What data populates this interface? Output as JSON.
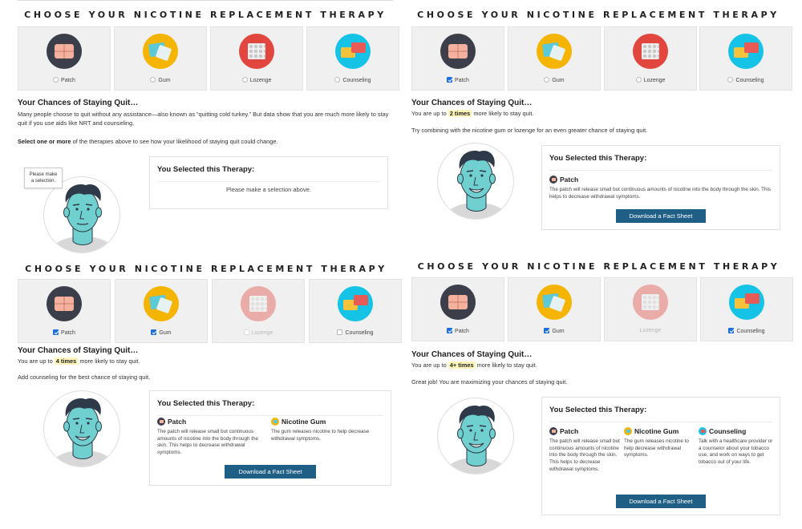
{
  "heading": "CHOOSE YOUR NICOTINE REPLACEMENT THERAPY",
  "options": [
    "Patch",
    "Gum",
    "Lozenge",
    "Counseling"
  ],
  "chances_title": "Your Chances of Staying Quit…",
  "selected_title": "You Selected this Therapy:",
  "download_label": "Download a Fact Sheet",
  "therapies": {
    "patch": {
      "name": "Patch",
      "desc": "The patch will release small but continuous amounts of nicotine into the body through the skin. This helps to decrease withdrawal symptoms."
    },
    "gum": {
      "name": "Nicotine Gum",
      "desc": "The gum releases nicotine to help decrease withdrawal symptoms."
    },
    "counseling": {
      "name": "Counseling",
      "desc": "Talk with a healthcare provider or a counselor about your tobacco use, and work on ways to get tobacco out of your life."
    }
  },
  "panel1": {
    "intro": "Many people choose to quit without any assistance—also known as “quitting cold turkey.” But data show that you are much more likely to stay quit if you use aids like NRT and counseling.",
    "instruction_bold": "Select one or more",
    "instruction_rest": " of the therapies above to see how your likelihood of staying quit could change.",
    "speech": "Please make a selection.",
    "empty_message": "Please make a selection above."
  },
  "panel2": {
    "prefix": "You are up to",
    "times": "2 times",
    "suffix": "more likely to stay quit.",
    "tip": "Try combining with the nicotine gum or lozenge for an even greater chance of staying quit."
  },
  "panel3": {
    "prefix": "You are up to",
    "times": "4 times",
    "suffix": "more likely to stay quit.",
    "tip": "Add counseling for the best chance of staying quit."
  },
  "panel4": {
    "prefix": "You are up to",
    "times": "4+ times",
    "suffix": "more likely to stay quit.",
    "tip": "Great job! You are maximizing your chances of staying quit."
  },
  "colors": {
    "patch": "#3c3f4a",
    "gum": "#f4b400",
    "lozenge": "#e2473f",
    "counseling": "#15c3e6",
    "skin": "#6fd0cf",
    "button": "#1f5f86",
    "highlight": "#fdf6b8"
  }
}
